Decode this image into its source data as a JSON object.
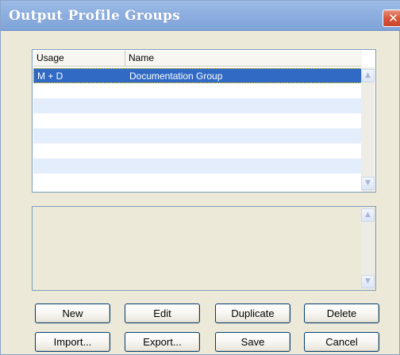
{
  "window": {
    "title": "Output Profile Groups",
    "close_glyph": "✕"
  },
  "list": {
    "columns": [
      "Usage",
      "Name"
    ],
    "rows": [
      {
        "usage": "M + D",
        "name": "Documentation Group",
        "selected": true
      }
    ],
    "scroll_up_glyph": "▲",
    "scroll_down_glyph": "▼"
  },
  "description": {
    "text": "",
    "scroll_up_glyph": "▲",
    "scroll_down_glyph": "▼"
  },
  "buttons": {
    "new": "New",
    "edit": "Edit",
    "duplicate": "Duplicate",
    "delete": "Delete",
    "import": "Import...",
    "export": "Export...",
    "save": "Save",
    "cancel": "Cancel"
  },
  "colors": {
    "selection": "#316ac5",
    "title_bar": "#8fb0e0",
    "alt_row": "#e3edfb",
    "dialog_bg": "#ece9d8"
  },
  "icons": {
    "close": "close-icon",
    "scroll_up": "chevron-up-icon",
    "scroll_down": "chevron-down-icon"
  }
}
